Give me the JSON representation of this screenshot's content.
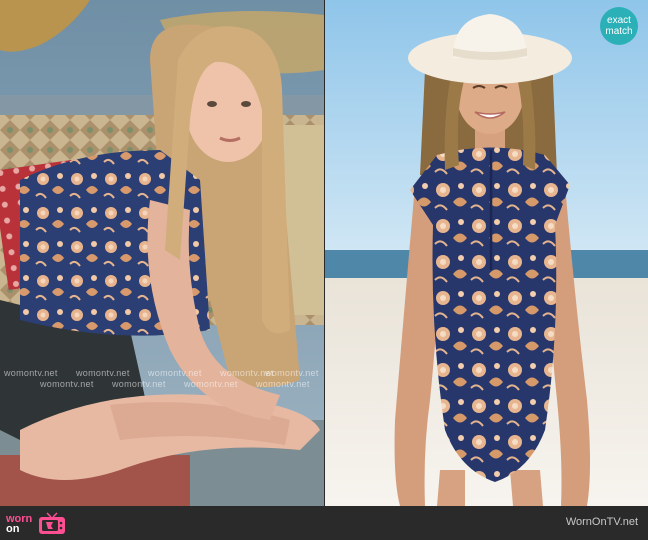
{
  "badge": {
    "line1": "exact",
    "line2": "match",
    "color": "#2bb0b8"
  },
  "watermark": {
    "text": "womontv.net"
  },
  "logo": {
    "word1": "worn",
    "word2": "on",
    "accent_color": "#ff4f93",
    "tv_icon": "tv-icon"
  },
  "footer": {
    "url": "WornOnTV.net"
  }
}
